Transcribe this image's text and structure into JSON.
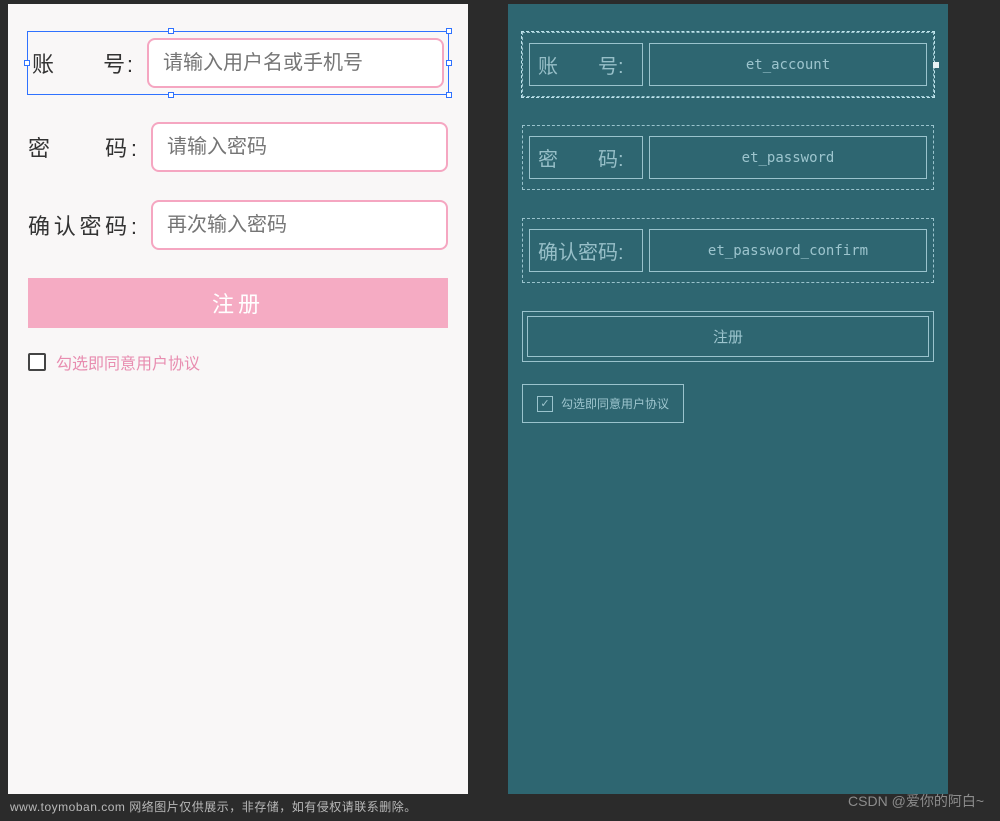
{
  "preview": {
    "rows": {
      "account": {
        "label": "账　　号:",
        "placeholder": "请输入用户名或手机号"
      },
      "password": {
        "label": "密　　码:",
        "placeholder": "请输入密码"
      },
      "confirm": {
        "label": "确认密码:",
        "placeholder": "再次输入密码"
      }
    },
    "register_label": "注册",
    "agree_label": "勾选即同意用户协议"
  },
  "blueprint": {
    "rows": {
      "account": {
        "label": "账　　号:",
        "id": "et_account"
      },
      "password": {
        "label": "密　　码:",
        "id": "et_password"
      },
      "confirm": {
        "label": "确认密码:",
        "id": "et_password_confirm"
      }
    },
    "register_label": "注册",
    "agree_label": "勾选即同意用户协议"
  },
  "watermark_left": "www.toymoban.com 网络图片仅供展示，非存储，如有侵权请联系删除。",
  "watermark_right": "CSDN @爱你的阿白~"
}
